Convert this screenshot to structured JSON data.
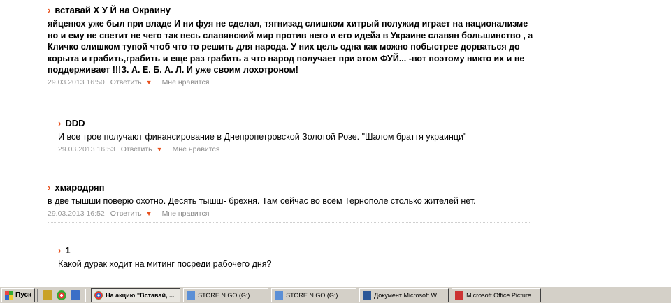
{
  "comments": [
    {
      "author": "вставай Х У Й на Окраину",
      "text": "яйценюх уже был при владе И ни фуя не сделал, тягнизад слишком хитрый полужид играет на национализме но и ему не светит не чего так весь славянский мир против него и его идейа в Украине славян большинство , а Кличко слишком тупой чтоб что то решить для народа. У них цель одна как можно побыстрее дорваться до корыта и грабить,грабить и еще раз грабить а что народ получает при этом ФУЙ... -вот поэтому никто их и не поддерживает !!!З. А. Е. Б. А. Л. И уже своим лохотроном!",
      "date": "29.03.2013 16:50",
      "reply": "Ответить",
      "like": "Мне нравится"
    },
    {
      "author": "DDD",
      "text": "И все трое получают финансирование в Днепропетровской Золотой Розе. \"Шалом браття украинци\"",
      "date": "29.03.2013 16:53",
      "reply": "Ответить",
      "like": "Мне нравится"
    },
    {
      "author": "хмародряп",
      "text": "в две тышши поверю охотно. Десять тышш- брехня. Там сейчас во всём Тернополе столько жителей нет.",
      "date": "29.03.2013 16:52",
      "reply": "Ответить",
      "like": "Мне нравится"
    },
    {
      "author": "1",
      "text": "Какой дурак ходит на митинг посреди рабочего дня?"
    }
  ],
  "taskbar": {
    "start_label": "Пуск",
    "tasks": [
      "На акцию \"Вставай, ...",
      "STORE N GO (G:)",
      "STORE N GO (G:)",
      "Документ Microsoft Wor...",
      "Microsoft Office Picture ..."
    ]
  },
  "colors": {
    "accent": "#e8501c",
    "meta_text": "#9a9a9a",
    "taskbar_bg": "#d4d0c8"
  }
}
